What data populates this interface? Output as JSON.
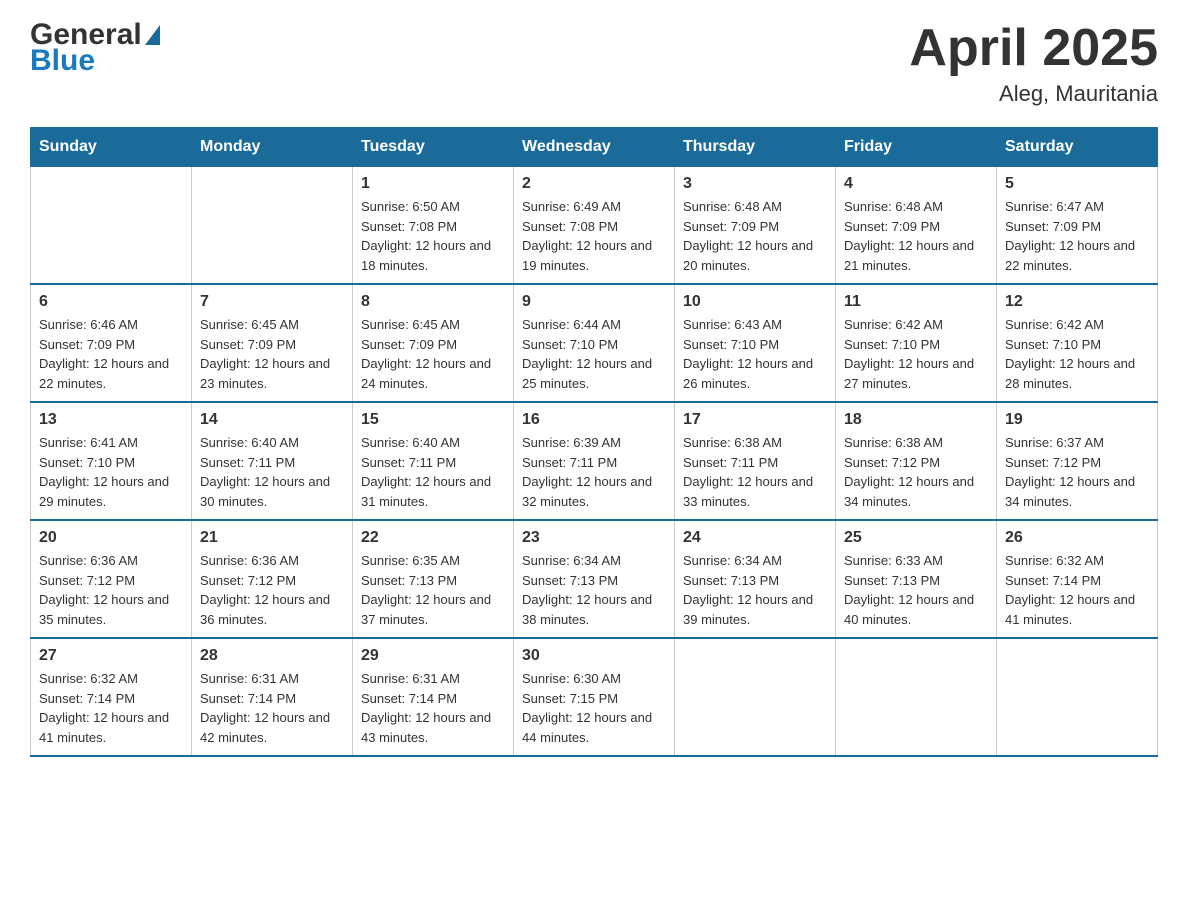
{
  "header": {
    "logo_general": "General",
    "logo_blue": "Blue",
    "title": "April 2025",
    "subtitle": "Aleg, Mauritania"
  },
  "calendar": {
    "days_of_week": [
      "Sunday",
      "Monday",
      "Tuesday",
      "Wednesday",
      "Thursday",
      "Friday",
      "Saturday"
    ],
    "weeks": [
      [
        {
          "day": "",
          "sunrise": "",
          "sunset": "",
          "daylight": ""
        },
        {
          "day": "",
          "sunrise": "",
          "sunset": "",
          "daylight": ""
        },
        {
          "day": "1",
          "sunrise": "Sunrise: 6:50 AM",
          "sunset": "Sunset: 7:08 PM",
          "daylight": "Daylight: 12 hours and 18 minutes."
        },
        {
          "day": "2",
          "sunrise": "Sunrise: 6:49 AM",
          "sunset": "Sunset: 7:08 PM",
          "daylight": "Daylight: 12 hours and 19 minutes."
        },
        {
          "day": "3",
          "sunrise": "Sunrise: 6:48 AM",
          "sunset": "Sunset: 7:09 PM",
          "daylight": "Daylight: 12 hours and 20 minutes."
        },
        {
          "day": "4",
          "sunrise": "Sunrise: 6:48 AM",
          "sunset": "Sunset: 7:09 PM",
          "daylight": "Daylight: 12 hours and 21 minutes."
        },
        {
          "day": "5",
          "sunrise": "Sunrise: 6:47 AM",
          "sunset": "Sunset: 7:09 PM",
          "daylight": "Daylight: 12 hours and 22 minutes."
        }
      ],
      [
        {
          "day": "6",
          "sunrise": "Sunrise: 6:46 AM",
          "sunset": "Sunset: 7:09 PM",
          "daylight": "Daylight: 12 hours and 22 minutes."
        },
        {
          "day": "7",
          "sunrise": "Sunrise: 6:45 AM",
          "sunset": "Sunset: 7:09 PM",
          "daylight": "Daylight: 12 hours and 23 minutes."
        },
        {
          "day": "8",
          "sunrise": "Sunrise: 6:45 AM",
          "sunset": "Sunset: 7:09 PM",
          "daylight": "Daylight: 12 hours and 24 minutes."
        },
        {
          "day": "9",
          "sunrise": "Sunrise: 6:44 AM",
          "sunset": "Sunset: 7:10 PM",
          "daylight": "Daylight: 12 hours and 25 minutes."
        },
        {
          "day": "10",
          "sunrise": "Sunrise: 6:43 AM",
          "sunset": "Sunset: 7:10 PM",
          "daylight": "Daylight: 12 hours and 26 minutes."
        },
        {
          "day": "11",
          "sunrise": "Sunrise: 6:42 AM",
          "sunset": "Sunset: 7:10 PM",
          "daylight": "Daylight: 12 hours and 27 minutes."
        },
        {
          "day": "12",
          "sunrise": "Sunrise: 6:42 AM",
          "sunset": "Sunset: 7:10 PM",
          "daylight": "Daylight: 12 hours and 28 minutes."
        }
      ],
      [
        {
          "day": "13",
          "sunrise": "Sunrise: 6:41 AM",
          "sunset": "Sunset: 7:10 PM",
          "daylight": "Daylight: 12 hours and 29 minutes."
        },
        {
          "day": "14",
          "sunrise": "Sunrise: 6:40 AM",
          "sunset": "Sunset: 7:11 PM",
          "daylight": "Daylight: 12 hours and 30 minutes."
        },
        {
          "day": "15",
          "sunrise": "Sunrise: 6:40 AM",
          "sunset": "Sunset: 7:11 PM",
          "daylight": "Daylight: 12 hours and 31 minutes."
        },
        {
          "day": "16",
          "sunrise": "Sunrise: 6:39 AM",
          "sunset": "Sunset: 7:11 PM",
          "daylight": "Daylight: 12 hours and 32 minutes."
        },
        {
          "day": "17",
          "sunrise": "Sunrise: 6:38 AM",
          "sunset": "Sunset: 7:11 PM",
          "daylight": "Daylight: 12 hours and 33 minutes."
        },
        {
          "day": "18",
          "sunrise": "Sunrise: 6:38 AM",
          "sunset": "Sunset: 7:12 PM",
          "daylight": "Daylight: 12 hours and 34 minutes."
        },
        {
          "day": "19",
          "sunrise": "Sunrise: 6:37 AM",
          "sunset": "Sunset: 7:12 PM",
          "daylight": "Daylight: 12 hours and 34 minutes."
        }
      ],
      [
        {
          "day": "20",
          "sunrise": "Sunrise: 6:36 AM",
          "sunset": "Sunset: 7:12 PM",
          "daylight": "Daylight: 12 hours and 35 minutes."
        },
        {
          "day": "21",
          "sunrise": "Sunrise: 6:36 AM",
          "sunset": "Sunset: 7:12 PM",
          "daylight": "Daylight: 12 hours and 36 minutes."
        },
        {
          "day": "22",
          "sunrise": "Sunrise: 6:35 AM",
          "sunset": "Sunset: 7:13 PM",
          "daylight": "Daylight: 12 hours and 37 minutes."
        },
        {
          "day": "23",
          "sunrise": "Sunrise: 6:34 AM",
          "sunset": "Sunset: 7:13 PM",
          "daylight": "Daylight: 12 hours and 38 minutes."
        },
        {
          "day": "24",
          "sunrise": "Sunrise: 6:34 AM",
          "sunset": "Sunset: 7:13 PM",
          "daylight": "Daylight: 12 hours and 39 minutes."
        },
        {
          "day": "25",
          "sunrise": "Sunrise: 6:33 AM",
          "sunset": "Sunset: 7:13 PM",
          "daylight": "Daylight: 12 hours and 40 minutes."
        },
        {
          "day": "26",
          "sunrise": "Sunrise: 6:32 AM",
          "sunset": "Sunset: 7:14 PM",
          "daylight": "Daylight: 12 hours and 41 minutes."
        }
      ],
      [
        {
          "day": "27",
          "sunrise": "Sunrise: 6:32 AM",
          "sunset": "Sunset: 7:14 PM",
          "daylight": "Daylight: 12 hours and 41 minutes."
        },
        {
          "day": "28",
          "sunrise": "Sunrise: 6:31 AM",
          "sunset": "Sunset: 7:14 PM",
          "daylight": "Daylight: 12 hours and 42 minutes."
        },
        {
          "day": "29",
          "sunrise": "Sunrise: 6:31 AM",
          "sunset": "Sunset: 7:14 PM",
          "daylight": "Daylight: 12 hours and 43 minutes."
        },
        {
          "day": "30",
          "sunrise": "Sunrise: 6:30 AM",
          "sunset": "Sunset: 7:15 PM",
          "daylight": "Daylight: 12 hours and 44 minutes."
        },
        {
          "day": "",
          "sunrise": "",
          "sunset": "",
          "daylight": ""
        },
        {
          "day": "",
          "sunrise": "",
          "sunset": "",
          "daylight": ""
        },
        {
          "day": "",
          "sunrise": "",
          "sunset": "",
          "daylight": ""
        }
      ]
    ]
  }
}
